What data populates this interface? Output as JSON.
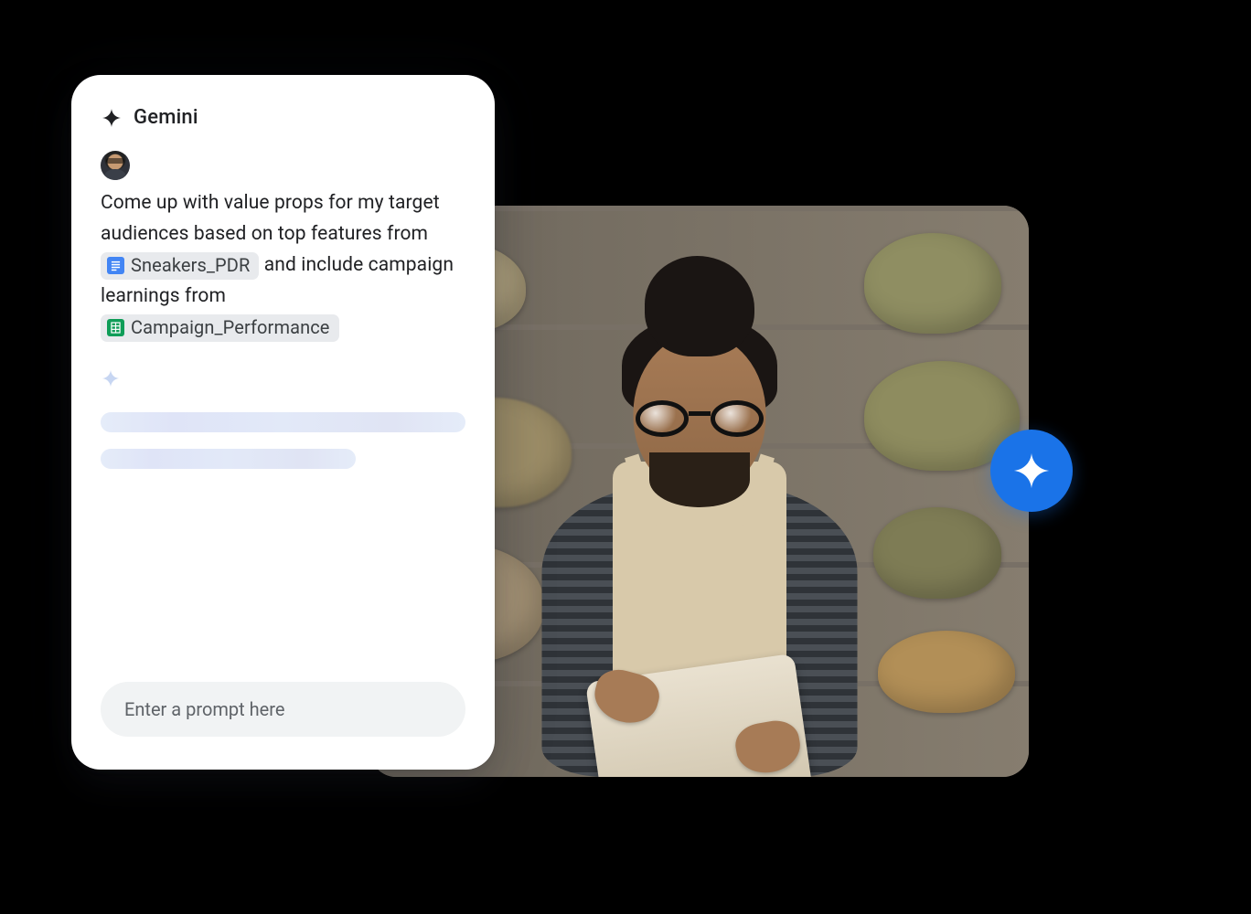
{
  "panel": {
    "title": "Gemini",
    "prompt": {
      "seg1": "Come up with value props for my target audiences based on top features from ",
      "chip1": {
        "label": "Sneakers_PDR",
        "app": "docs"
      },
      "seg2": " and include campaign learnings from ",
      "chip2": {
        "label": "Campaign_Performance",
        "app": "sheets"
      }
    },
    "input": {
      "placeholder": "Enter a prompt here"
    }
  }
}
